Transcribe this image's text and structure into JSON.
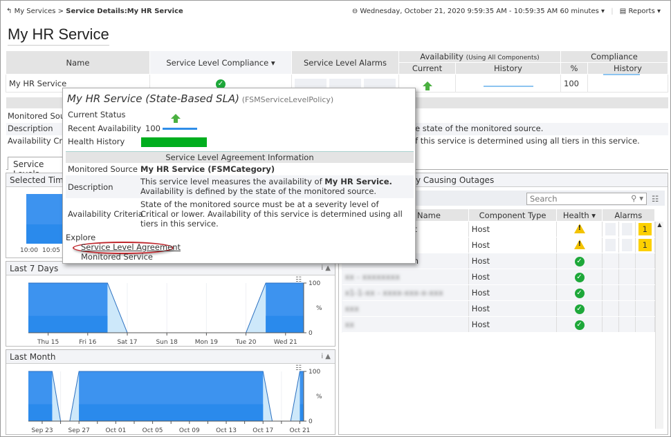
{
  "breadcrumb": {
    "parent": "My Services",
    "separator": ">",
    "current": "Service Details:My HR Service"
  },
  "time_range": {
    "label": "Wednesday, October 21, 2020 9:59:35 AM - 10:59:35 AM 60 minutes"
  },
  "reports_label": "Reports",
  "page_title": "My HR Service",
  "summary_table": {
    "headers": {
      "name": "Name",
      "compliance": "Service Level Compliance",
      "alarms": "Service Level Alarms",
      "availability": "Availability",
      "availability_note": "(Using All Components)",
      "current": "Current",
      "history": "History",
      "compliance_group": "Compliance",
      "percent": "%",
      "compliance_history": "History"
    },
    "row": {
      "name": "My HR Service",
      "compliance_status": "ok",
      "current": "up",
      "percent": "100"
    }
  },
  "info_rows": {
    "monitored_source": "Monitored Source",
    "description": "Description",
    "availability_criteria": "Availability Criteria",
    "description_tail": "e state of the monitored source.",
    "criteria_tail": "f this service is determined using all tiers in this service."
  },
  "tabs": {
    "service_levels": "Service Levels"
  },
  "popup": {
    "title": "My HR Service (State-Based SLA)",
    "type": "(FSMServiceLevelPolicy)",
    "current_status_label": "Current Status",
    "recent_availability_label": "Recent Availability",
    "recent_availability_value": "100",
    "health_history_label": "Health History",
    "section_title": "Service Level Agreement Information",
    "monitored_source_label": "Monitored Source",
    "monitored_source_value": "My HR Service (FSMCategory)",
    "description_label": "Description",
    "description_pre": "This service level measures the availability of ",
    "description_bold": "My HR Service.",
    "description_post": "Availability is defined by the state of the monitored source.",
    "criteria_label": "Availability Criteria",
    "criteria_value": "State of the monitored source must be at a severity level of Critical or lower. Availability of this service is determined using all tiers in this service.",
    "explore_label": "Explore",
    "links": [
      "Service Level Agreement",
      "Monitored Service"
    ]
  },
  "panels": {
    "selected_time": "Selected Time",
    "last_7_days": "Last 7 Days",
    "last_month": "Last Month",
    "outages": "bly Causing Outages"
  },
  "selected_time_ticks": [
    "10:00",
    "10:05"
  ],
  "search": {
    "placeholder": "Search"
  },
  "components": {
    "headers": [
      "Name",
      "Component Type",
      "Health",
      "Alarms"
    ],
    "rows": [
      {
        "name": "ft",
        "type": "Host",
        "health": "warning",
        "alarm": "1"
      },
      {
        "name": "",
        "type": "Host",
        "health": "warning",
        "alarm": "1"
      },
      {
        "name": "in",
        "type": "Host",
        "health": "ok",
        "alarm": ""
      },
      {
        "name": "xx - xxxxxxxx",
        "type": "Host",
        "health": "ok",
        "alarm": ""
      },
      {
        "name": "x1-1-xx - xxxx-xxx-x-xxx",
        "type": "Host",
        "health": "ok",
        "alarm": ""
      },
      {
        "name": "xxx",
        "type": "Host",
        "health": "ok",
        "alarm": ""
      },
      {
        "name": "xx",
        "type": "Host",
        "health": "ok",
        "alarm": ""
      }
    ]
  },
  "colors": {
    "area": "#3d93ef",
    "area_dark": "#2a8aec",
    "partial": "#cde8fa",
    "ok": "#1ea83a",
    "warning": "#f3c300",
    "alarm": "#fcd000"
  },
  "chart_data": [
    {
      "type": "area",
      "title": "Last 7 Days",
      "ylabel": "%",
      "ylim": [
        0,
        100
      ],
      "yticks": [
        "0",
        "100"
      ],
      "xlim": [
        "2020-10-14T12:00",
        "2020-10-21T11:00"
      ],
      "xticks": [
        {
          "d": "2020-10-15",
          "label": "Thu 15"
        },
        {
          "d": "2020-10-16",
          "label": "Fri 16"
        },
        {
          "d": "2020-10-17",
          "label": "Sat 17"
        },
        {
          "d": "2020-10-18",
          "label": "Sun 18"
        },
        {
          "d": "2020-10-19",
          "label": "Mon 19"
        },
        {
          "d": "2020-10-20",
          "label": "Tue 20"
        },
        {
          "d": "2020-10-21",
          "label": "Wed 21"
        }
      ],
      "points": [
        [
          "2020-10-14T12:00",
          100
        ],
        [
          "2020-10-16T12:00",
          100
        ],
        [
          "2020-10-17T00:00",
          0
        ],
        [
          "2020-10-20T00:00",
          0
        ],
        [
          "2020-10-20T12:00",
          100
        ],
        [
          "2020-10-21T11:00",
          100
        ]
      ]
    },
    {
      "type": "area",
      "title": "Last Month",
      "ylabel": "%",
      "ylim": [
        0,
        100
      ],
      "yticks": [
        "0",
        "100"
      ],
      "xlim": [
        "2020-09-21T12:00",
        "2020-10-21T10:00"
      ],
      "xticks": [
        {
          "d": "2020-09-23",
          "label": "Sep 23"
        },
        {
          "d": "2020-09-25",
          "label": ""
        },
        {
          "d": "2020-09-27",
          "label": "Sep 27"
        },
        {
          "d": "2020-09-29",
          "label": ""
        },
        {
          "d": "2020-10-01",
          "label": "Oct 01"
        },
        {
          "d": "2020-10-03",
          "label": ""
        },
        {
          "d": "2020-10-05",
          "label": "Oct 05"
        },
        {
          "d": "2020-10-07",
          "label": ""
        },
        {
          "d": "2020-10-09",
          "label": "Oct 09"
        },
        {
          "d": "2020-10-11",
          "label": ""
        },
        {
          "d": "2020-10-13",
          "label": "Oct 13"
        },
        {
          "d": "2020-10-15",
          "label": ""
        },
        {
          "d": "2020-10-17",
          "label": "Oct 17"
        },
        {
          "d": "2020-10-19",
          "label": ""
        },
        {
          "d": "2020-10-21",
          "label": "Oct 21"
        }
      ],
      "points": [
        [
          "2020-09-21T12:00",
          100
        ],
        [
          "2020-09-24T02:00",
          100
        ],
        [
          "2020-09-25T00:00",
          0
        ],
        [
          "2020-09-26T00:00",
          0
        ],
        [
          "2020-09-27T00:00",
          100
        ],
        [
          "2020-10-17T00:00",
          100
        ],
        [
          "2020-10-18T00:00",
          0
        ],
        [
          "2020-10-20T00:00",
          0
        ],
        [
          "2020-10-21T00:00",
          100
        ],
        [
          "2020-10-21T10:00",
          100
        ]
      ]
    }
  ]
}
